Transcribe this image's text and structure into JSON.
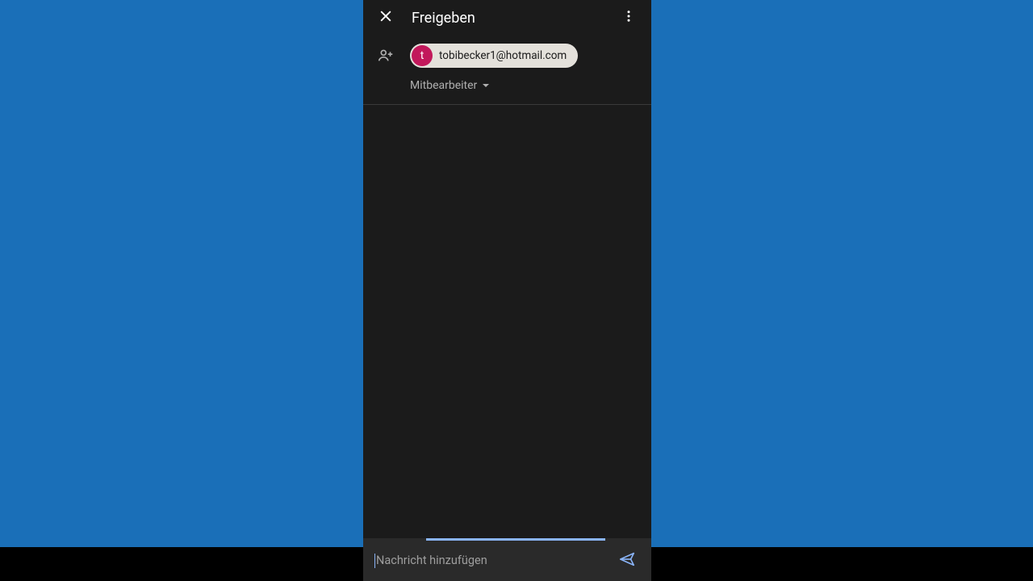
{
  "header": {
    "title": "Freigeben"
  },
  "recipient": {
    "avatar_letter": "t",
    "email": "tobibecker1@hotmail.com",
    "role": "Mitbearbeiter"
  },
  "message": {
    "placeholder": "Nachricht hinzufügen"
  }
}
